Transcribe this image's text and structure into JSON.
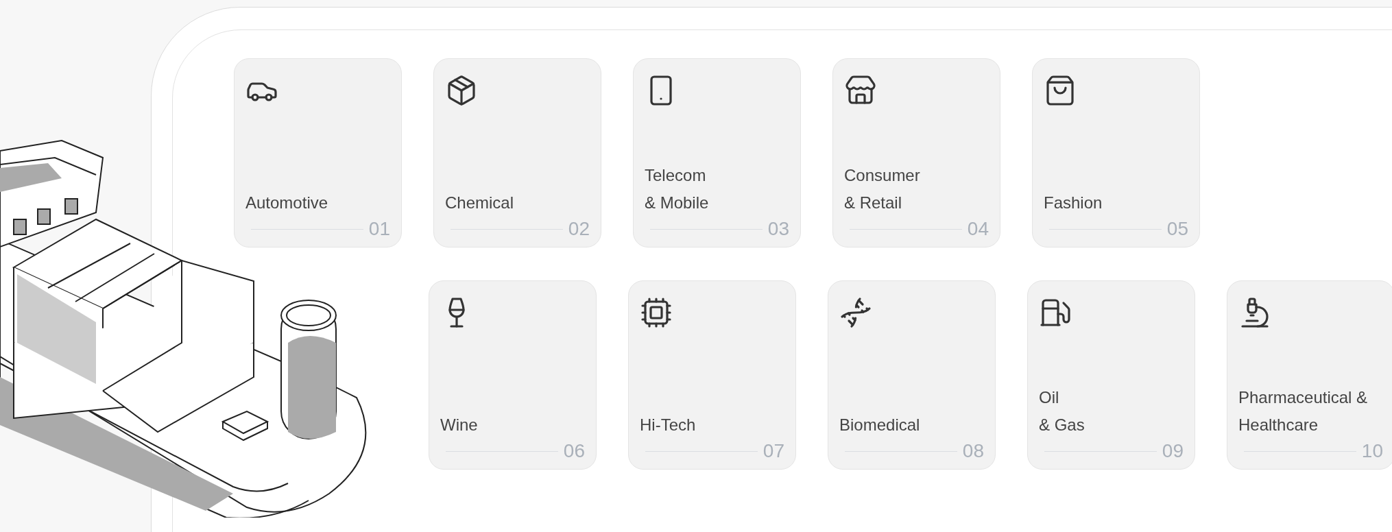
{
  "rows": [
    {
      "cards": [
        {
          "label_lines": [
            "Automotive"
          ],
          "number": "01"
        },
        {
          "label_lines": [
            "Chemical"
          ],
          "number": "02"
        },
        {
          "label_lines": [
            "Telecom",
            "& Mobile"
          ],
          "number": "03"
        },
        {
          "label_lines": [
            "Consumer",
            "& Retail"
          ],
          "number": "04"
        },
        {
          "label_lines": [
            "Fashion"
          ],
          "number": "05"
        }
      ]
    },
    {
      "cards": [
        {
          "label_lines": [
            "Wine"
          ],
          "number": "06"
        },
        {
          "label_lines": [
            "Hi-Tech"
          ],
          "number": "07"
        },
        {
          "label_lines": [
            "Biomedical"
          ],
          "number": "08"
        },
        {
          "label_lines": [
            "Oil",
            "& Gas"
          ],
          "number": "09"
        },
        {
          "label_lines": [
            "Pharmaceutical &",
            "Healthcare"
          ],
          "number": "10"
        }
      ]
    }
  ]
}
